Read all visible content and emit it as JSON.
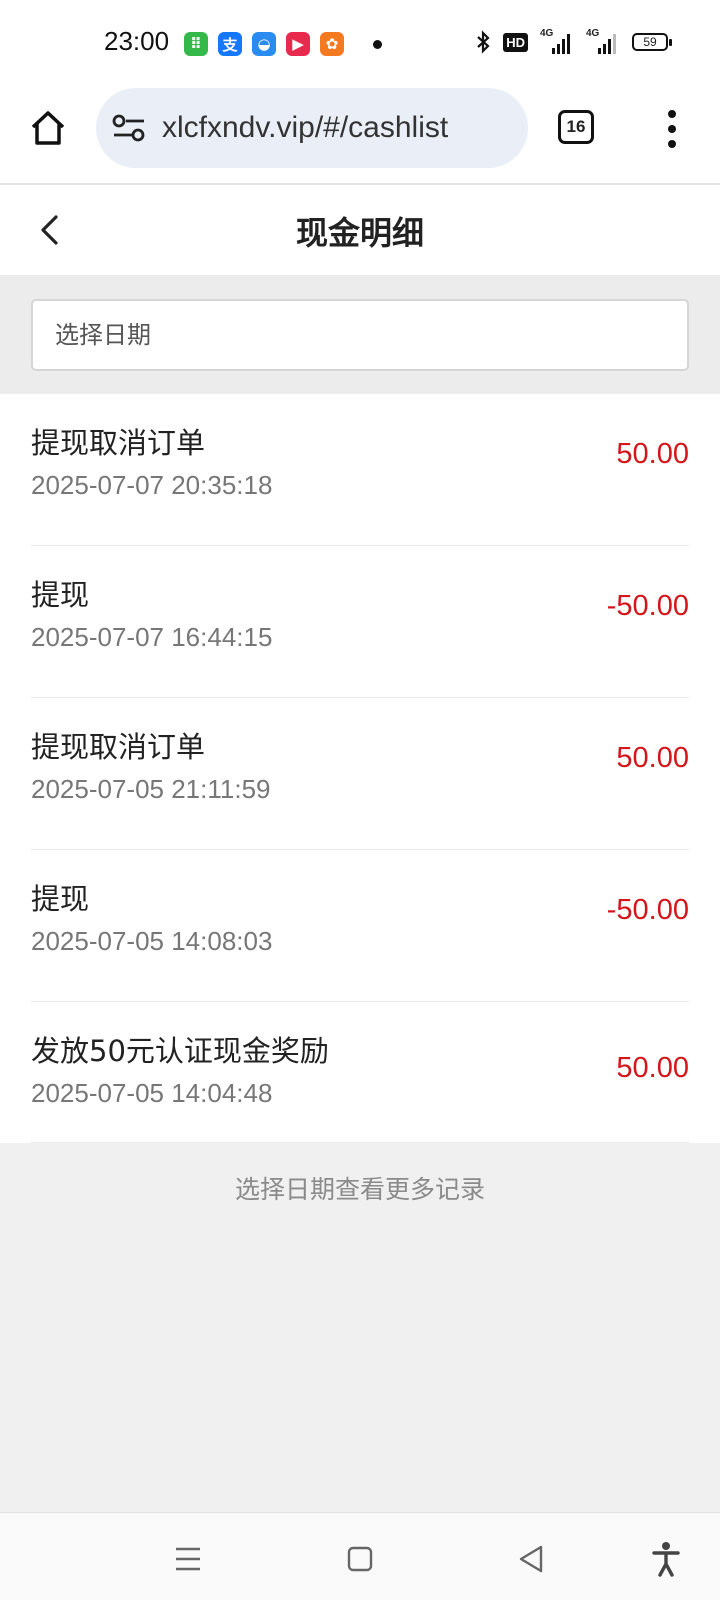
{
  "status_bar": {
    "time": "23:00",
    "app_icons": [
      {
        "name": "android-store-icon",
        "color": "#35b84a",
        "glyph": "⠿"
      },
      {
        "name": "alipay-icon",
        "color": "#1677ff",
        "glyph": "支"
      },
      {
        "name": "cloud-icon",
        "color": "#2a8cf0",
        "glyph": "◒"
      },
      {
        "name": "video-icon",
        "color": "#e82a4e",
        "glyph": "▶"
      },
      {
        "name": "orange-app-icon",
        "color": "#f47a22",
        "glyph": "✿"
      }
    ],
    "hd_label": "HD",
    "signal1_label": "4G",
    "signal2_label": "4G",
    "battery": "59"
  },
  "browser": {
    "url": "xlcfxndv.vip/#/cashlist",
    "tab_count": "16"
  },
  "header": {
    "title": "现金明细"
  },
  "date_filter": {
    "placeholder": "选择日期"
  },
  "records": [
    {
      "title": "提现取消订单",
      "time": "2025-07-07 20:35:18",
      "amount": "50.00"
    },
    {
      "title": "提现",
      "time": "2025-07-07 16:44:15",
      "amount": "-50.00"
    },
    {
      "title": "提现取消订单",
      "time": "2025-07-05 21:11:59",
      "amount": "50.00"
    },
    {
      "title": "提现",
      "time": "2025-07-05 14:08:03",
      "amount": "-50.00"
    },
    {
      "title": "发放50元认证现金奖励",
      "time": "2025-07-05 14:04:48",
      "amount": "50.00"
    }
  ],
  "footer_hint": "选择日期查看更多记录",
  "colors": {
    "amount": "#d4161c",
    "omnibox": "#e9eef7",
    "page_bg": "#f0f0f0"
  }
}
